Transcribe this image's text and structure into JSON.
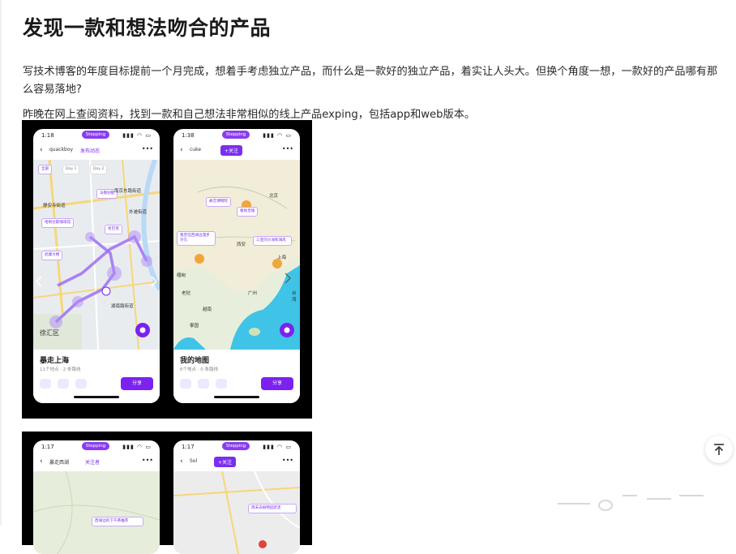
{
  "article": {
    "title": "发现一款和想法吻合的产品",
    "paragraph1": "写技术博客的年度目标提前一个月完成，想着手考虑独立产品，而什么是一款好的独立产品，着实让人头大。但换个角度一想，一款好的产品哪有那么容易落地?",
    "paragraph2": "昨晚在网上查阅资料，找到一款和自己想法非常相似的线上产品exping，包括app和web版本。"
  },
  "screenshot1": {
    "left": {
      "time": "1:18",
      "brand": "Stepping",
      "user": "quackboy",
      "link": "发布动态",
      "chips": [
        "全部",
        "Day 1",
        "Day 2"
      ],
      "bubbles": [
        "马勒别墅",
        "哈根达斯咖啡馆",
        "星巴克",
        "武康大楼"
      ],
      "labels": [
        "静安寺街道",
        "南京东路街道",
        "外滩街道",
        "徐汇区",
        "湖南路街道"
      ],
      "sheet_title": "暴走上海",
      "sheet_sub": "11个地点 · 2 条路线",
      "share": "分享"
    },
    "right": {
      "time": "1:38",
      "brand": "Stepping",
      "user": "cuke",
      "tag": "+关注",
      "bubbles": [
        "故宫博物院",
        "秦始皇陵",
        "我曾在西湖边漫步许久",
        "三亚的沙滩和海风"
      ],
      "labels": [
        "北京",
        "上海",
        "广州",
        "西安",
        "越南",
        "老挝",
        "泰国",
        "缅甸",
        "台湾"
      ],
      "sheet_title": "我的地图",
      "sheet_sub": "6个地点 · 0 条路线",
      "share": "分享"
    }
  },
  "screenshot2": {
    "left": {
      "time": "1:17",
      "brand": "Stepping",
      "user": "暴走西湖",
      "link": "关注者",
      "bubble": "西湖边的下午茶推荐"
    },
    "right": {
      "time": "1:17",
      "brand": "Stepping",
      "user": "Sol",
      "tag": "+关注",
      "bubble": "周末去植物园走走"
    }
  },
  "icons": {
    "scroll_top": "arrow-up-to-line-icon",
    "locate": "locate-icon",
    "back": "chevron-left-icon",
    "more": "more-dots-icon"
  },
  "colors": {
    "accent": "#7b21f0",
    "map_route": "#8a5cf0",
    "sea": "#3fc3e6"
  }
}
